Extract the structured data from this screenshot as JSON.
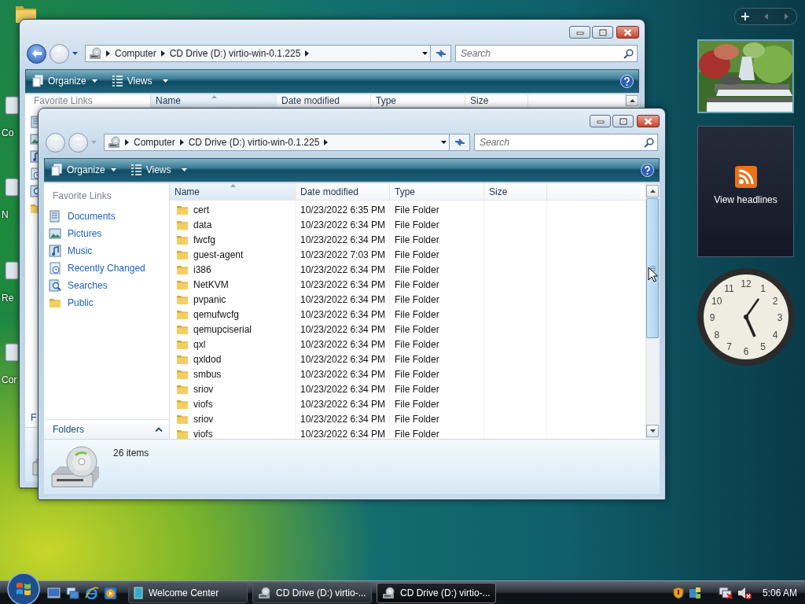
{
  "desktop": {
    "icons": [
      {
        "label": "Co"
      },
      {
        "label": "N"
      },
      {
        "label": "Re"
      },
      {
        "label": "Cor"
      }
    ]
  },
  "windows": [
    {
      "back_enabled": true,
      "breadcrumb": [
        "Computer",
        "CD Drive (D:) virtio-win-0.1.225"
      ],
      "search": {
        "placeholder": "Search"
      },
      "toolbar": [
        "Organize",
        "Views"
      ],
      "columns": [
        "Name",
        "Date modified",
        "Type",
        "Size"
      ],
      "favorite_links_heading": "Favorite Links",
      "folders_label": "F"
    },
    {
      "back_enabled": false,
      "breadcrumb": [
        "Computer",
        "CD Drive (D:) virtio-win-0.1.225"
      ],
      "search": {
        "placeholder": "Search"
      },
      "toolbar": [
        "Organize",
        "Views"
      ],
      "columns": [
        "Name",
        "Date modified",
        "Type",
        "Size"
      ],
      "favorite_links_heading": "Favorite Links",
      "favorite_links": [
        "Documents",
        "Pictures",
        "Music",
        "Recently Changed",
        "Searches",
        "Public"
      ],
      "folders_label": "Folders",
      "rows": [
        {
          "name": "cert",
          "date": "10/23/2022 6:35 PM",
          "type": "File Folder"
        },
        {
          "name": "data",
          "date": "10/23/2022 6:34 PM",
          "type": "File Folder"
        },
        {
          "name": "fwcfg",
          "date": "10/23/2022 6:34 PM",
          "type": "File Folder"
        },
        {
          "name": "guest-agent",
          "date": "10/23/2022 7:03 PM",
          "type": "File Folder"
        },
        {
          "name": "i386",
          "date": "10/23/2022 6:34 PM",
          "type": "File Folder"
        },
        {
          "name": "NetKVM",
          "date": "10/23/2022 6:34 PM",
          "type": "File Folder"
        },
        {
          "name": "pvpanic",
          "date": "10/23/2022 6:34 PM",
          "type": "File Folder"
        },
        {
          "name": "qemufwcfg",
          "date": "10/23/2022 6:34 PM",
          "type": "File Folder"
        },
        {
          "name": "qemupciserial",
          "date": "10/23/2022 6:34 PM",
          "type": "File Folder"
        },
        {
          "name": "qxl",
          "date": "10/23/2022 6:34 PM",
          "type": "File Folder"
        },
        {
          "name": "qxldod",
          "date": "10/23/2022 6:34 PM",
          "type": "File Folder"
        },
        {
          "name": "smbus",
          "date": "10/23/2022 6:34 PM",
          "type": "File Folder"
        },
        {
          "name": "sriov",
          "date": "10/23/2022 6:34 PM",
          "type": "File Folder"
        },
        {
          "name": "viofs",
          "date": "10/23/2022 6:34 PM",
          "type": "File Folder"
        },
        {
          "name": "sriov",
          "date": "10/23/2022 6:34 PM",
          "type": "File Folder"
        },
        {
          "name": "viofs",
          "date": "10/23/2022 6:34 PM",
          "type": "File Folder"
        }
      ],
      "status": "26 items"
    }
  ],
  "gadgets": {
    "feed": {
      "label": "View headlines"
    },
    "clock": {
      "numerals": [
        "12",
        "11",
        "1",
        "10",
        "2",
        "9",
        "3",
        "8",
        "4",
        "7",
        "5",
        "6"
      ]
    }
  },
  "taskbar": {
    "tasks": [
      {
        "label": "Welcome Center",
        "selected": false
      },
      {
        "label": "CD Drive (D:) virtio-...",
        "selected": false
      },
      {
        "label": "CD Drive (D:) virtio-...",
        "selected": true
      }
    ],
    "clock": "5:06 AM"
  }
}
